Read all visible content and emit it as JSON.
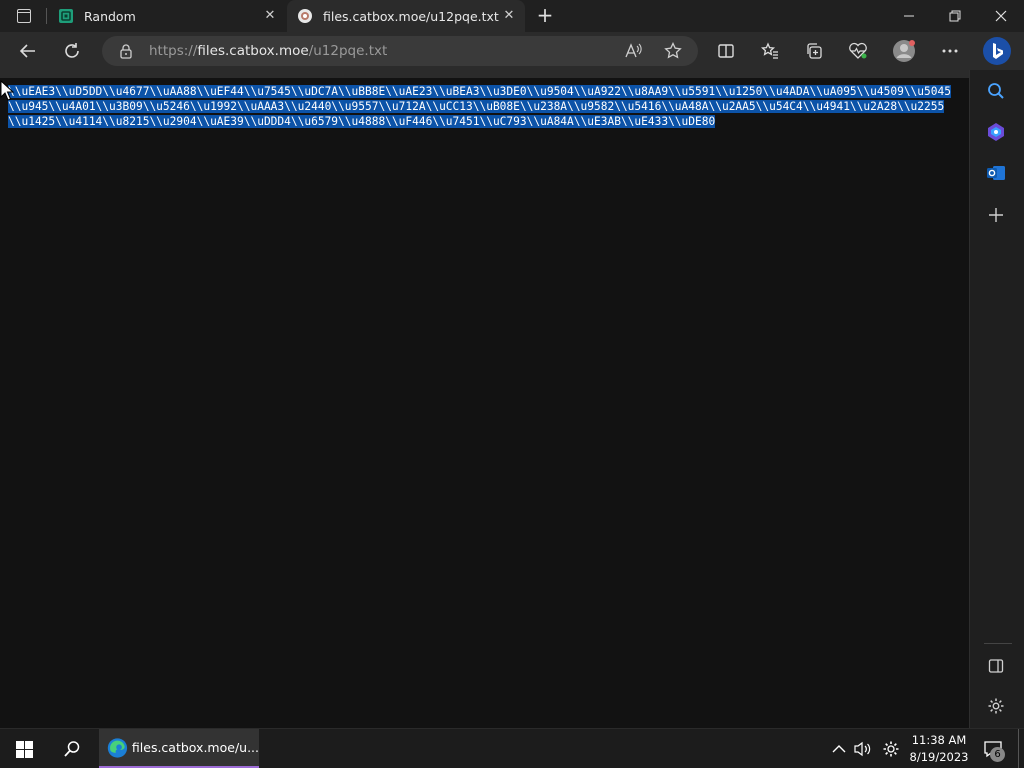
{
  "tabs": [
    {
      "label": "Random",
      "favicon": "random-favicon",
      "active": false
    },
    {
      "label": "files.catbox.moe/u12pqe.txt",
      "favicon": "catbox-favicon",
      "active": true
    }
  ],
  "address_bar": {
    "url_prefix": "https://",
    "url_host": "files.catbox.moe",
    "url_path": "/u12pqe.txt"
  },
  "content": {
    "text": "\\\\uEAE3\\\\uD5DD\\\\u4677\\\\uAA88\\\\uEF44\\\\u7545\\\\uDC7A\\\\uBB8E\\\\uAE23\\\\uBEA3\\\\u3DE0\\\\u9504\\\\uA922\\\\u8AA9\\\\u5591\\\\u1250\\\\u4ADA\\\\uA095\\\\u4509\\\\u5045\\\\u945\\\\u4A01\\\\u3B09\\\\u5246\\\\u1992\\\\uAAA3\\\\u2440\\\\u9557\\\\u712A\\\\uCC13\\\\uB08E\\\\u238A\\\\u9582\\\\u5416\\\\uA48A\\\\u2AA5\\\\u54C4\\\\u4941\\\\u2A28\\\\u2255\\\\u1425\\\\u4114\\\\u8215\\\\u2904\\\\uAE39\\\\uDDD4\\\\u6579\\\\u4888\\\\uF446\\\\u7451\\\\uC793\\\\uA84A\\\\uE3AB\\\\uE433\\\\uDE80",
    "selected": true
  },
  "taskbar": {
    "edge_label": "files.catbox.moe/u...",
    "time": "11:38 AM",
    "date": "8/19/2023",
    "notification_count": "6"
  },
  "colors": {
    "selection": "#0c53a8",
    "taskbar_accent": "#9d6cd6",
    "random_favicon": "#1e9e7a"
  }
}
